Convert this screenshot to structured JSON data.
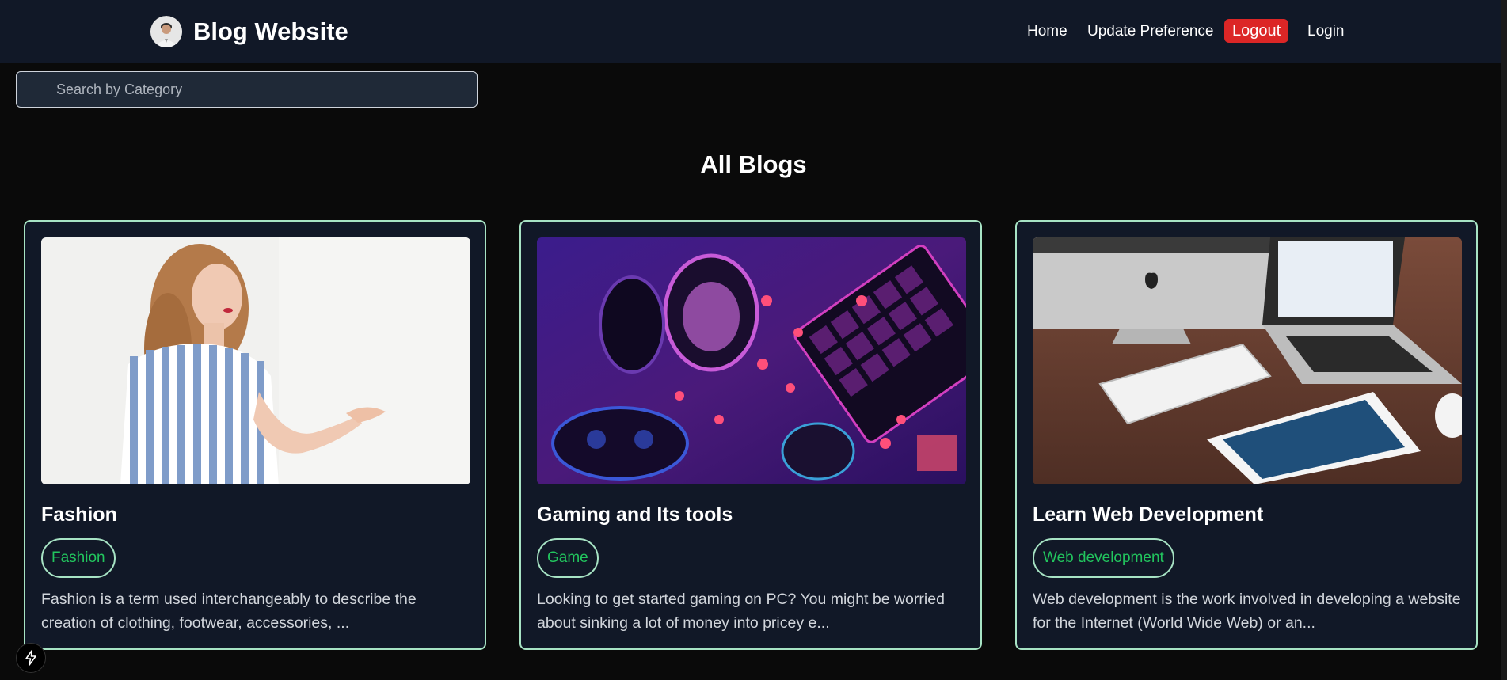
{
  "header": {
    "brand": "Blog Website",
    "nav": {
      "home": "Home",
      "update_preference": "Update Preference",
      "logout": "Logout",
      "login": "Login"
    }
  },
  "search": {
    "placeholder": "Search by Category",
    "value": ""
  },
  "page_title": "All Blogs",
  "blogs": [
    {
      "title": "Fashion",
      "tag": "Fashion",
      "description": "Fashion is a term used interchangeably to describe the creation of clothing, footwear, accessories, ..."
    },
    {
      "title": "Gaming and Its tools",
      "tag": "Game",
      "description": "Looking to get started gaming on PC? You might be worried about sinking a lot of money into pricey e..."
    },
    {
      "title": "Learn Web Development",
      "tag": "Web development",
      "description": "Web development is the work involved in developing a website for the Internet (World Wide Web) or an..."
    }
  ],
  "colors": {
    "navbar_bg": "#111827",
    "page_bg": "#0a0a0a",
    "card_bg": "#111827",
    "card_border": "#a7e3c4",
    "tag_text": "#22c55e",
    "logout_bg": "#dc2626"
  },
  "icons": {
    "avatar": "user-avatar",
    "bolt": "lightning-bolt-icon"
  }
}
